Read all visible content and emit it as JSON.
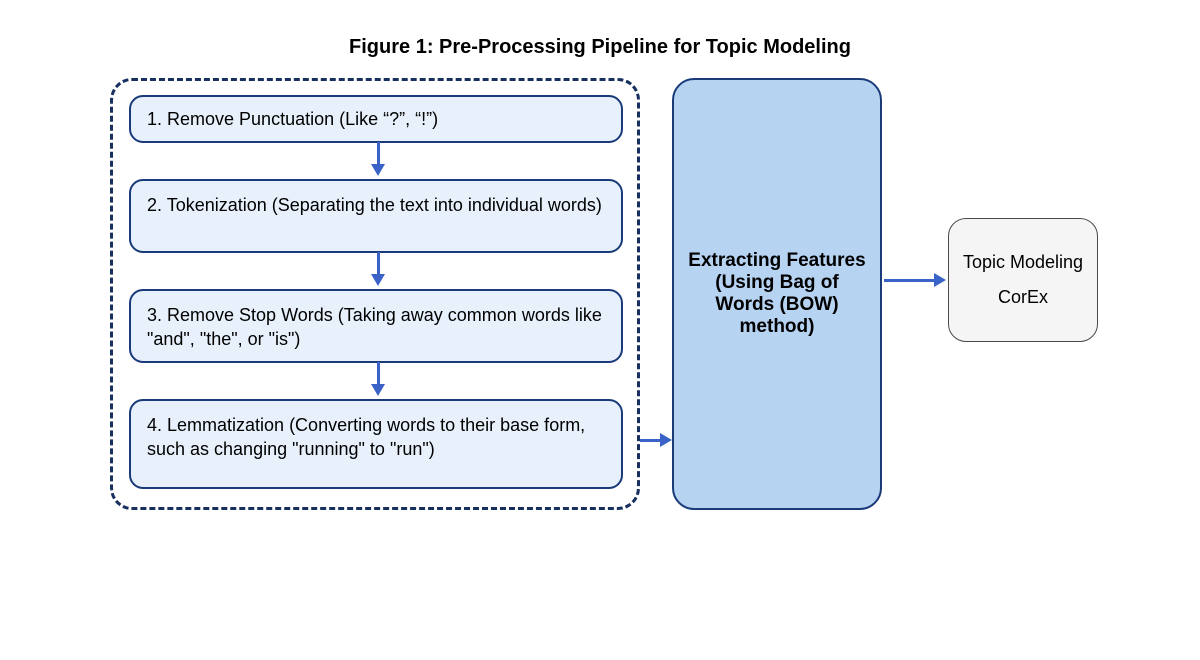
{
  "title": "Figure 1: Pre-Processing Pipeline for Topic Modeling",
  "steps": {
    "s1": "1. Remove Punctuation (Like “?”, “!”)",
    "s2": "2. Tokenization (Separating the text into individual words)",
    "s3": "3. Remove Stop Words (Taking away common words like \"and\", \"the\", or \"is\")",
    "s4": "4. Lemmatization (Converting words to their base form, such as changing \"running\" to \"run\")"
  },
  "feature_box": "Extracting Features (Using Bag of Words (BOW) method)",
  "topic_box": {
    "line1": "Topic Modeling",
    "line2": "CorEx"
  }
}
